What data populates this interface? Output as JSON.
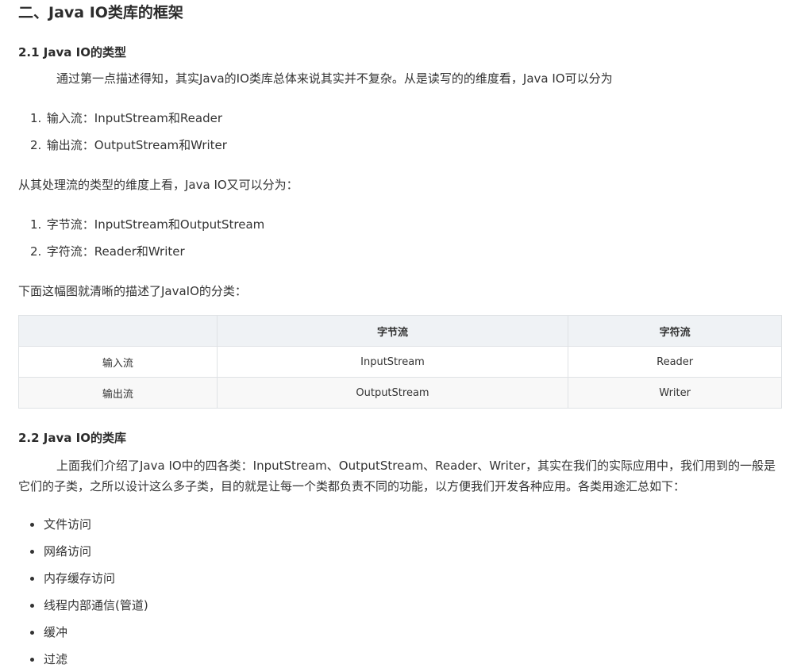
{
  "section_title": "二、Java IO类库的框架",
  "s21": {
    "heading": "2.1 Java IO的类型",
    "intro": "通过第一点描述得知，其实Java的IO类库总体来说其实并不复杂。从是读写的的维度看，Java IO可以分为",
    "direction_list": [
      {
        "num": "1.",
        "text": "输入流：InputStream和Reader"
      },
      {
        "num": "2.",
        "text": "输出流：OutputStream和Writer"
      }
    ],
    "type_intro": "从其处理流的类型的维度上看，Java IO又可以分为：",
    "type_list": [
      {
        "num": "1.",
        "text": "字节流：InputStream和OutputStream"
      },
      {
        "num": "2.",
        "text": "字符流：Reader和Writer"
      }
    ],
    "table_intro": "下面这幅图就清晰的描述了JavaIO的分类：",
    "table": {
      "headers": [
        "",
        "字节流",
        "字符流"
      ],
      "rows": [
        [
          "输入流",
          "InputStream",
          "Reader"
        ],
        [
          "输出流",
          "OutputStream",
          "Writer"
        ]
      ]
    }
  },
  "s22": {
    "heading": "2.2 Java IO的类库",
    "paragraph": "上面我们介绍了Java IO中的四各类：InputStream、OutputStream、Reader、Writer，其实在我们的实际应用中，我们用到的一般是它们的子类，之所以设计这么多子类，目的就是让每一个类都负责不同的功能，以方便我们开发各种应用。各类用途汇总如下：",
    "uses": [
      "文件访问",
      "网络访问",
      "内存缓存访问",
      "线程内部通信(管道)",
      "缓冲",
      "过滤"
    ]
  }
}
